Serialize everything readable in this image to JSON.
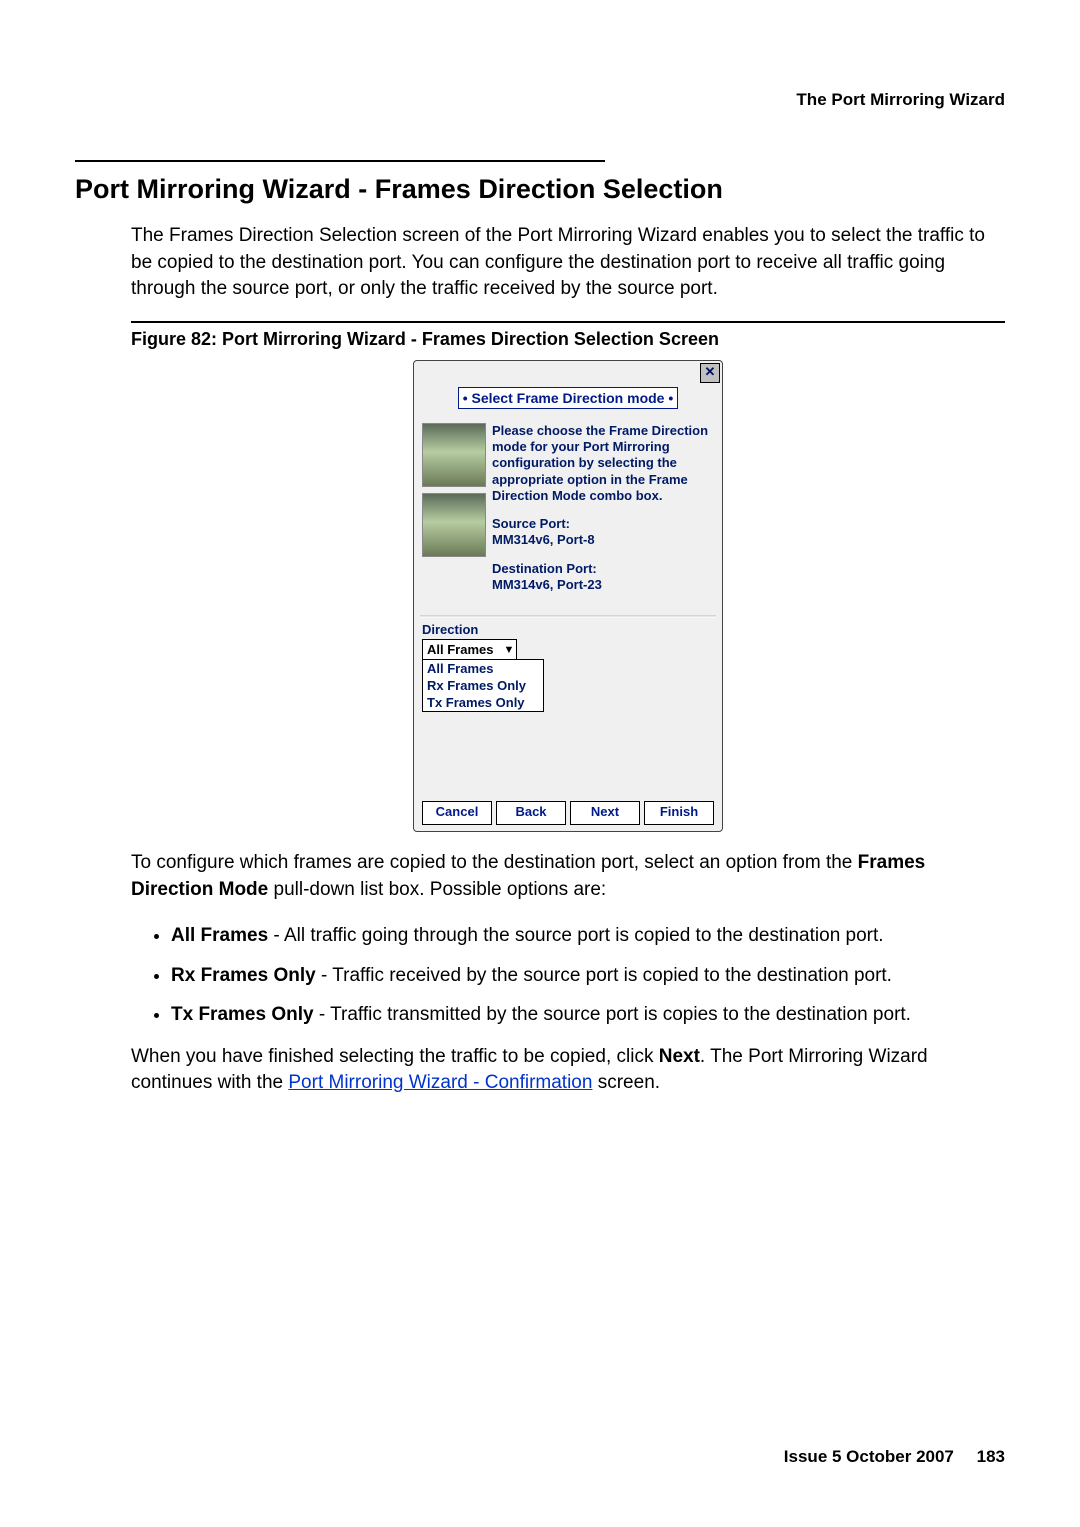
{
  "header": {
    "right": "The Port Mirroring Wizard"
  },
  "section": {
    "title": "Port Mirroring Wizard - Frames Direction Selection",
    "intro": "The Frames Direction Selection screen of the Port Mirroring Wizard enables you to select the traffic to be copied to the destination port. You can configure the destination port to receive all traffic going through the source port, or only the traffic received by the source port."
  },
  "figure": {
    "caption": "Figure 82: Port Mirroring Wizard - Frames Direction Selection Screen"
  },
  "wizard": {
    "close_glyph": "✕",
    "title": "• Select Frame Direction mode •",
    "instruction": "Please choose the Frame Direction mode for your Port Mirroring configuration by selecting the appropriate option in the Frame Direction Mode combo box.",
    "source_label": "Source Port:",
    "source_value": "MM314v6, Port-8",
    "dest_label": "Destination Port:",
    "dest_value": "MM314v6, Port-23",
    "direction_label": "Direction",
    "combo_selected": "All Frames",
    "options": [
      "All Frames",
      "Rx Frames Only",
      "Tx Frames Only"
    ],
    "buttons": {
      "cancel": "Cancel",
      "back": "Back",
      "next": "Next",
      "finish": "Finish"
    }
  },
  "explain": {
    "lead_before": "To configure which frames are copied to the destination port, select an option from the ",
    "lead_bold": "Frames Direction Mode",
    "lead_after": " pull-down list box. Possible options are:",
    "opt1_bold": "All Frames",
    "opt1_rest": " - All traffic going through the source port is copied to the destination port.",
    "opt2_bold": "Rx Frames Only",
    "opt2_rest": " - Traffic received by the source port is copied to the destination port.",
    "opt3_bold": "Tx Frames Only",
    "opt3_rest": " - Traffic transmitted by the source port is copies to the destination port.",
    "closing_before": "When you have finished selecting the traffic to be copied, click ",
    "closing_bold": "Next",
    "closing_mid": ". The Port Mirroring Wizard continues with the ",
    "closing_link": "Port Mirroring Wizard - Confirmation",
    "closing_after": " screen."
  },
  "footer": {
    "issue": "Issue 5   October 2007",
    "page": "183"
  }
}
